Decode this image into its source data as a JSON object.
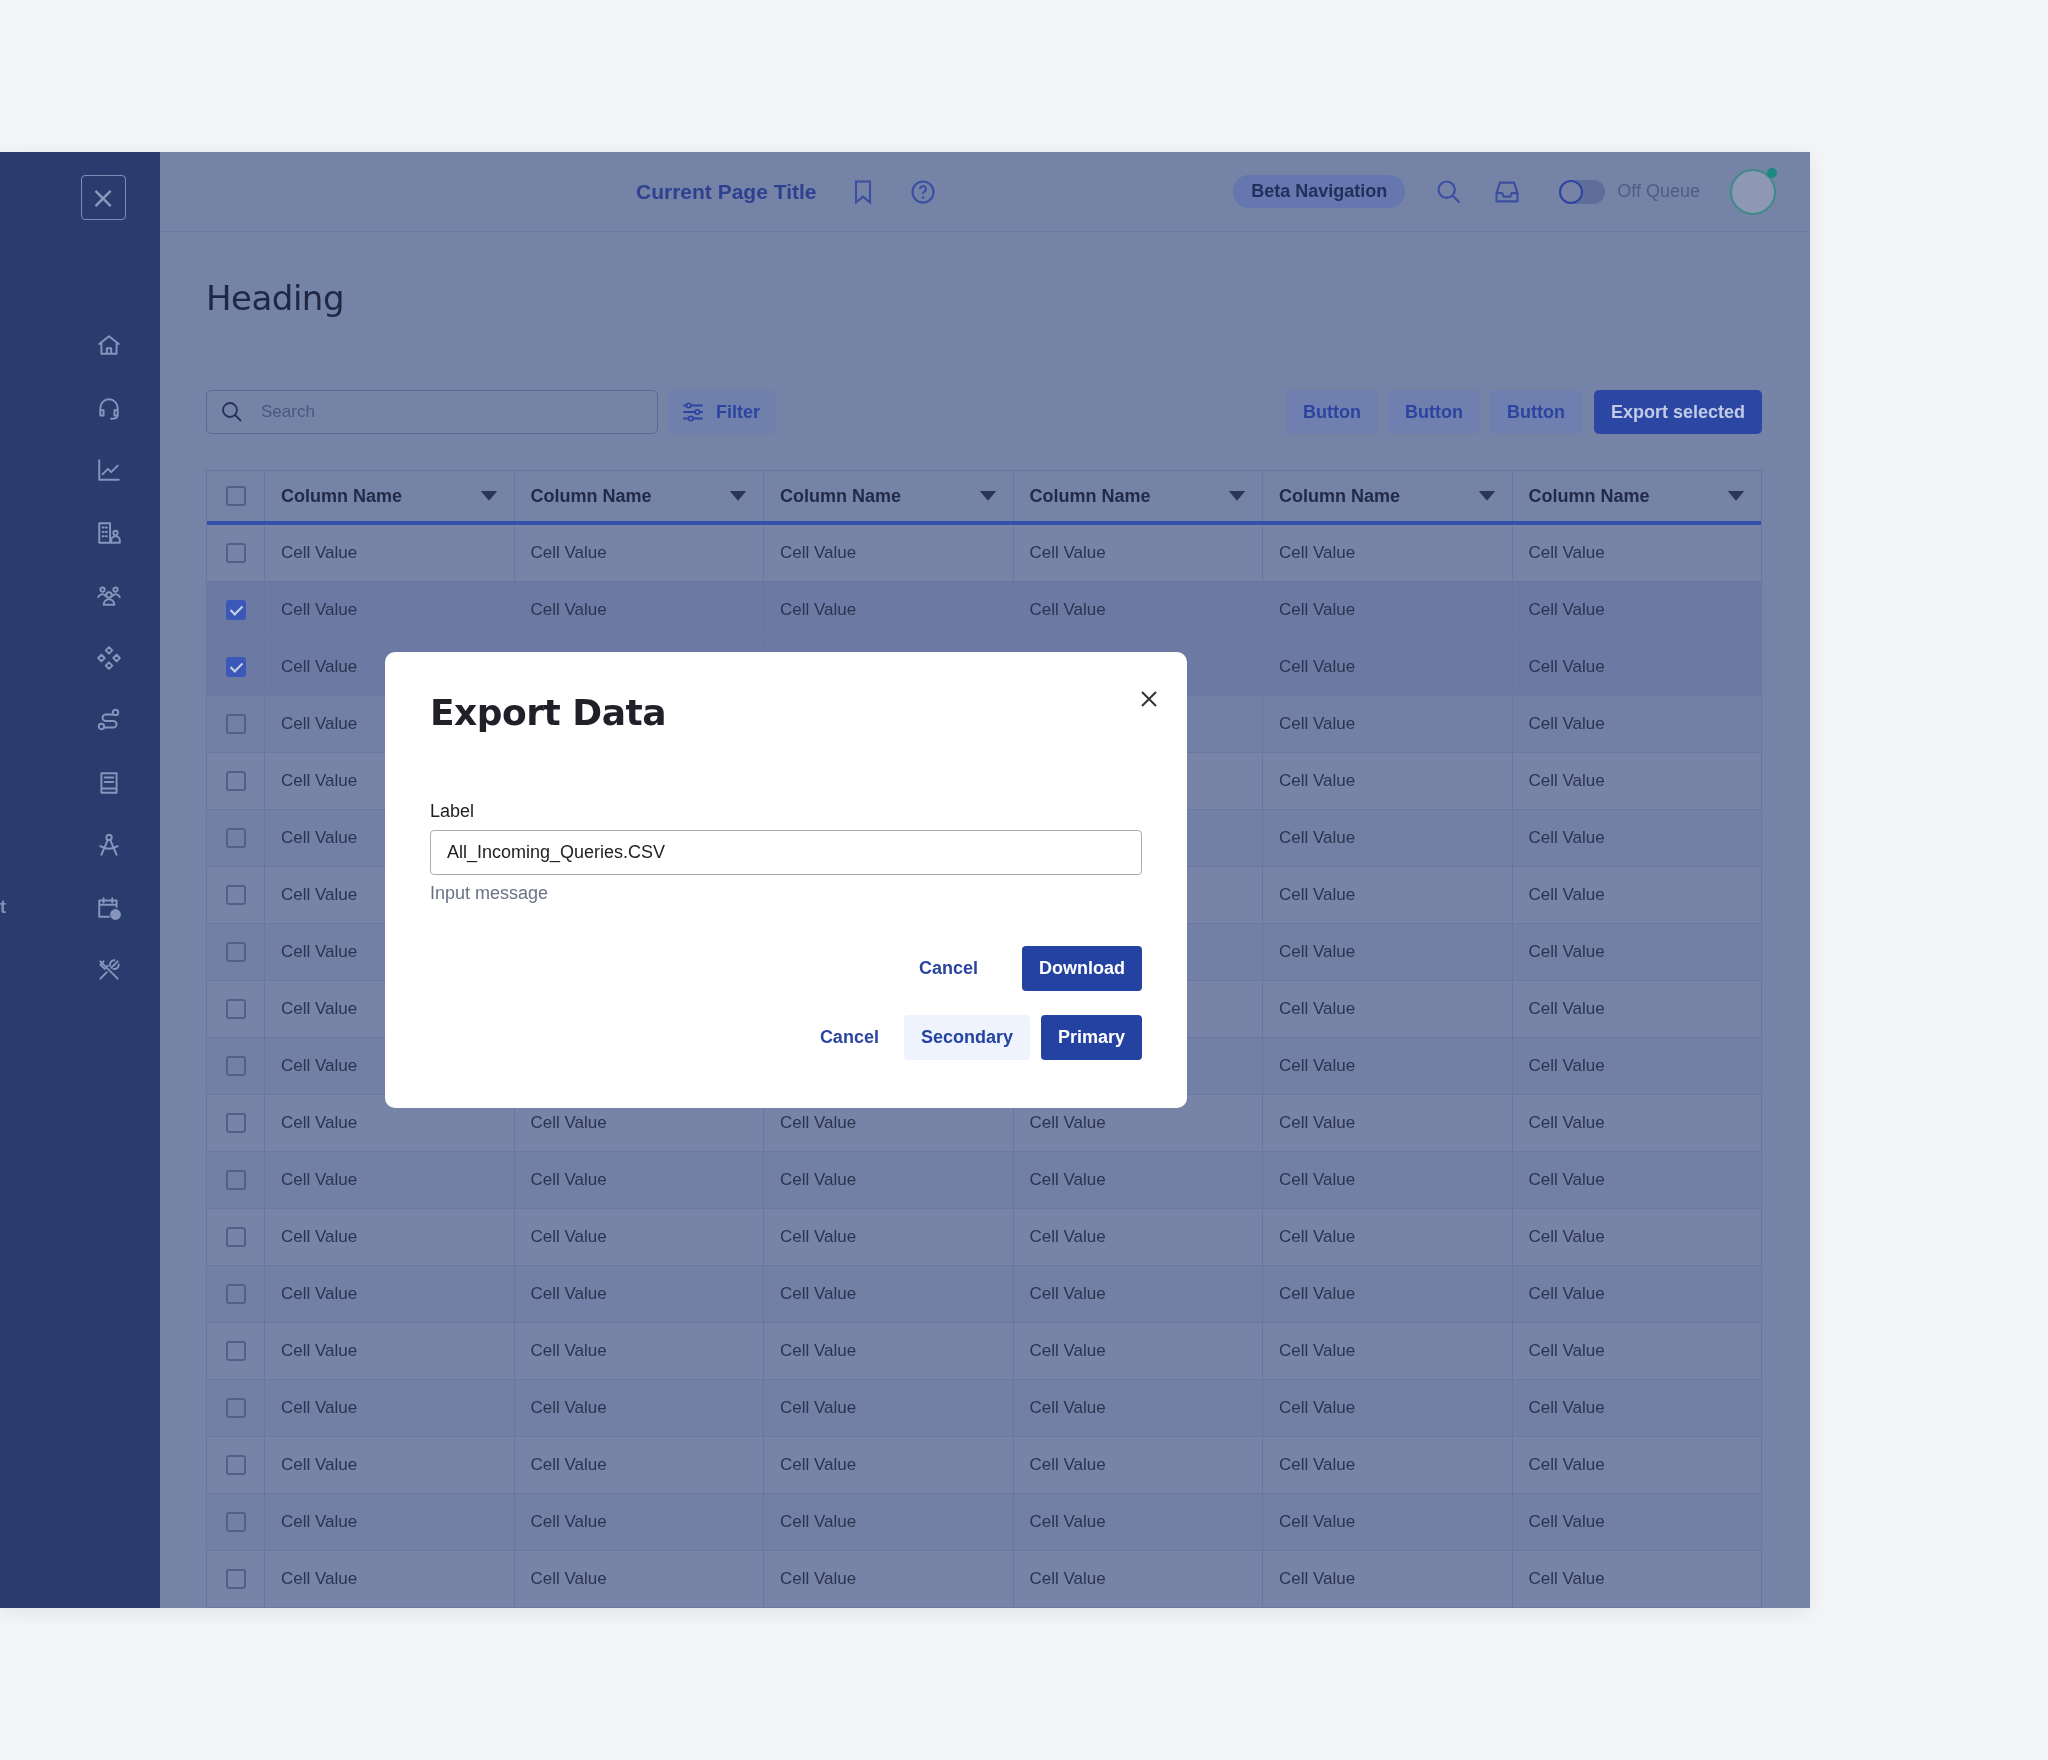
{
  "sidebar": {
    "close_button": "×",
    "cut_label": "t"
  },
  "header": {
    "title": "Current Page Title",
    "beta_badge": "Beta Navigation",
    "queue_toggle": {
      "on": false,
      "label": "Off Queue"
    }
  },
  "page": {
    "heading": "Heading"
  },
  "toolbar": {
    "search": {
      "placeholder": "Search"
    },
    "filter": "Filter",
    "buttons": [
      {
        "label": "Button",
        "kind": "secondary"
      },
      {
        "label": "Button",
        "kind": "secondary"
      },
      {
        "label": "Button",
        "kind": "secondary"
      },
      {
        "label": "Export selected",
        "kind": "primary"
      }
    ]
  },
  "table": {
    "select_all": {
      "checked": false
    },
    "columns": [
      "Column Name",
      "Column Name",
      "Column Name",
      "Column Name",
      "Column Name",
      "Column Name"
    ],
    "rows": [
      {
        "checked": false,
        "cells": [
          "Cell Value",
          "Cell Value",
          "Cell Value",
          "Cell Value",
          "Cell Value",
          "Cell Value"
        ]
      },
      {
        "checked": true,
        "cells": [
          "Cell Value",
          "Cell Value",
          "Cell Value",
          "Cell Value",
          "Cell Value",
          "Cell Value"
        ]
      },
      {
        "checked": true,
        "cells": [
          "Cell Value",
          null,
          null,
          null,
          "Cell Value",
          "Cell Value"
        ]
      },
      {
        "checked": false,
        "cells": [
          "Cell Value",
          null,
          null,
          null,
          "Cell Value",
          "Cell Value"
        ]
      },
      {
        "checked": false,
        "cells": [
          "Cell Value",
          null,
          null,
          null,
          "Cell Value",
          "Cell Value"
        ]
      },
      {
        "checked": false,
        "cells": [
          "Cell Value",
          null,
          null,
          null,
          "Cell Value",
          "Cell Value"
        ]
      },
      {
        "checked": false,
        "cells": [
          "Cell Value",
          null,
          null,
          null,
          "Cell Value",
          "Cell Value"
        ]
      },
      {
        "checked": false,
        "cells": [
          "Cell Value",
          null,
          null,
          null,
          "Cell Value",
          "Cell Value"
        ]
      },
      {
        "checked": false,
        "cells": [
          "Cell Value",
          null,
          null,
          null,
          "Cell Value",
          "Cell Value"
        ]
      },
      {
        "checked": false,
        "cells": [
          "Cell Value",
          null,
          null,
          null,
          "Cell Value",
          "Cell Value"
        ]
      },
      {
        "checked": false,
        "cells": [
          "Cell Value",
          "Cell Value",
          "Cell Value",
          "Cell Value",
          "Cell Value",
          "Cell Value"
        ]
      },
      {
        "checked": false,
        "cells": [
          "Cell Value",
          "Cell Value",
          "Cell Value",
          "Cell Value",
          "Cell Value",
          "Cell Value"
        ]
      },
      {
        "checked": false,
        "cells": [
          "Cell Value",
          "Cell Value",
          "Cell Value",
          "Cell Value",
          "Cell Value",
          "Cell Value"
        ]
      },
      {
        "checked": false,
        "cells": [
          "Cell Value",
          "Cell Value",
          "Cell Value",
          "Cell Value",
          "Cell Value",
          "Cell Value"
        ]
      },
      {
        "checked": false,
        "cells": [
          "Cell Value",
          "Cell Value",
          "Cell Value",
          "Cell Value",
          "Cell Value",
          "Cell Value"
        ]
      },
      {
        "checked": false,
        "cells": [
          "Cell Value",
          "Cell Value",
          "Cell Value",
          "Cell Value",
          "Cell Value",
          "Cell Value"
        ]
      },
      {
        "checked": false,
        "cells": [
          "Cell Value",
          "Cell Value",
          "Cell Value",
          "Cell Value",
          "Cell Value",
          "Cell Value"
        ]
      },
      {
        "checked": false,
        "cells": [
          "Cell Value",
          "Cell Value",
          "Cell Value",
          "Cell Value",
          "Cell Value",
          "Cell Value"
        ]
      },
      {
        "checked": false,
        "cells": [
          "Cell Value",
          "Cell Value",
          "Cell Value",
          "Cell Value",
          "Cell Value",
          "Cell Value"
        ]
      }
    ]
  },
  "dialog": {
    "title": "Export Data",
    "field": {
      "label": "Label",
      "value": "All_Incoming_Queries.CSV",
      "message": "Input message"
    },
    "action_rows": [
      [
        {
          "label": "Cancel",
          "kind": "text"
        },
        {
          "label": "Download",
          "kind": "primary"
        }
      ],
      [
        {
          "label": "Cancel",
          "kind": "text"
        },
        {
          "label": "Secondary",
          "kind": "secondary"
        },
        {
          "label": "Primary",
          "kind": "primary"
        }
      ]
    ]
  }
}
